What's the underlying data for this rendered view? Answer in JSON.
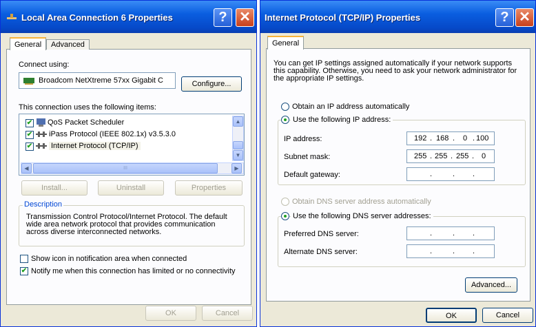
{
  "win1": {
    "title": "Local Area Connection 6 Properties",
    "help": "?",
    "close": "✕",
    "tabs": [
      "General",
      "Advanced"
    ],
    "connect_using_label": "Connect using:",
    "adapter_name": "Broadcom NetXtreme 57xx Gigabit C",
    "configure_label": "Configure...",
    "items_label": "This connection uses the following items:",
    "items": [
      {
        "label": "QoS Packet Scheduler",
        "checked": true
      },
      {
        "label": "iPass Protocol (IEEE 802.1x) v3.5.3.0",
        "checked": true
      },
      {
        "label": "Internet Protocol (TCP/IP)",
        "checked": true
      }
    ],
    "scroll_mid": "III",
    "install_label": "Install...",
    "uninstall_label": "Uninstall",
    "properties_label": "Properties",
    "description_label": "Description",
    "description_text": "Transmission Control Protocol/Internet Protocol. The default wide area network protocol that provides communication across diverse interconnected networks.",
    "show_icon_label": "Show icon in notification area when connected",
    "notify_label": "Notify me when this connection has limited or no connectivity",
    "ok_label": "OK",
    "cancel_label": "Cancel"
  },
  "win2": {
    "title": "Internet Protocol (TCP/IP) Properties",
    "help": "?",
    "close": "✕",
    "tab": "General",
    "intro": "You can get IP settings assigned automatically if your network supports this capability. Otherwise, you need to ask your network administrator for the appropriate IP settings.",
    "obtain_ip_label": "Obtain an IP address automatically",
    "use_ip_label": "Use the following IP address:",
    "ip_address_label": "IP address:",
    "ip_address": [
      "192",
      "168",
      "0",
      "100"
    ],
    "subnet_label": "Subnet mask:",
    "subnet": [
      "255",
      "255",
      "255",
      "0"
    ],
    "gateway_label": "Default gateway:",
    "obtain_dns_label": "Obtain DNS server address automatically",
    "use_dns_label": "Use the following DNS server addresses:",
    "preferred_dns_label": "Preferred DNS server:",
    "alternate_dns_label": "Alternate DNS server:",
    "dot": ".",
    "advanced_label": "Advanced...",
    "ok_label": "OK",
    "cancel_label": "Cancel"
  },
  "colors": {
    "titlebar": "#0a5ee0",
    "accent_check": "#21a121",
    "tab_highlight": "#f8b33a"
  }
}
